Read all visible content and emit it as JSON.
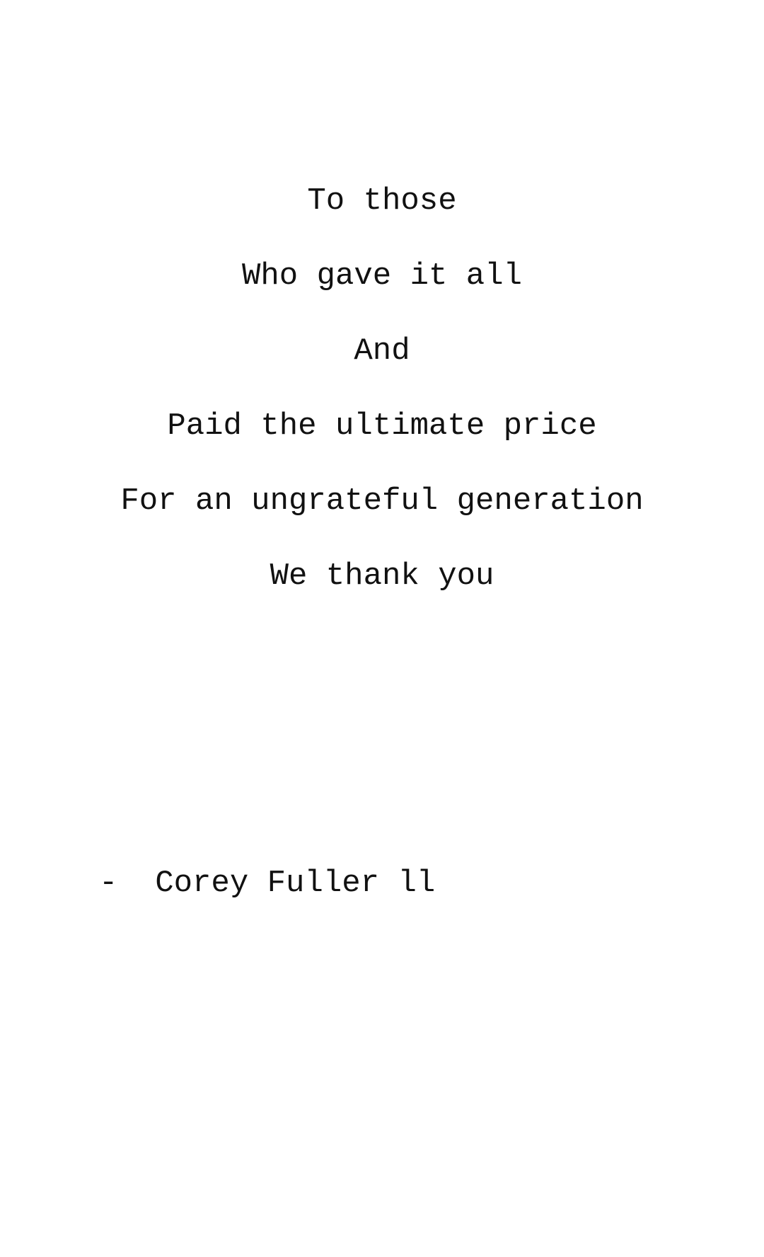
{
  "poem": {
    "lines": [
      "To those",
      "Who gave it all",
      "And",
      "Paid the ultimate price",
      "For an ungrateful generation",
      "We thank you"
    ]
  },
  "signature": {
    "text": "-  Corey Fuller ll"
  }
}
